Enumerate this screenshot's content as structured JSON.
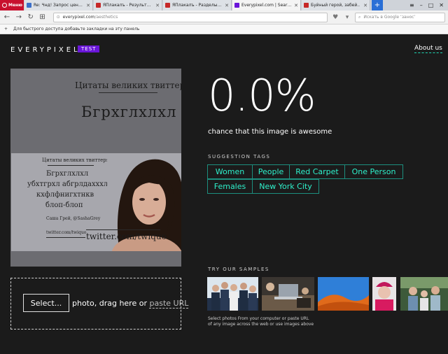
{
  "browser": {
    "menu_label": "Меню",
    "tabs": [
      {
        "title": "Re: Чнд! Запрос цены н...",
        "active": false,
        "favicon_color": "#3b6fc9"
      },
      {
        "title": "ЯПлакалъ - Результаты п...",
        "active": false,
        "favicon_color": "#c62828"
      },
      {
        "title": "ЯПлакалъ - Разделы и...",
        "active": false,
        "favicon_color": "#c62828"
      },
      {
        "title": "Everypixel.com | Search",
        "active": true,
        "favicon_color": "#6a16d9"
      },
      {
        "title": "Буйный герой, забей..",
        "active": false,
        "favicon_color": "#c62828"
      }
    ],
    "url_domain": "everypixel.com",
    "url_path": "/aesthetics",
    "search_placeholder": "Искать в Google ‘занос’",
    "bookmarks_hint": "Для быстрого доступа добавьте закладки на эту панель"
  },
  "header": {
    "logo": "EVERYPIXEL",
    "badge": "TEST",
    "about_link": "About us"
  },
  "image": {
    "poster_title": "Цитаты великих твиттерян",
    "poster_text_big": "Бгрхглхлхл",
    "inner_title": "Цитаты великих твиттерян",
    "inner_line1": "Бгрхглхлхл",
    "inner_line2": "убхтгрхл абгрлдахххлвимг",
    "inner_line3": "кхфлфнигхтнкв",
    "inner_line4": "блоп-блоп",
    "inner_author": "Саша Грей, @SashaGrey",
    "inner_link": "twitter.com/twiquo",
    "poster_link": "twitter.com/twiquo"
  },
  "upload": {
    "select_label": "Select...",
    "text_prefix": "photo, drag here or",
    "paste_link": "paste URL"
  },
  "result": {
    "score": "0.0%",
    "subtitle": "chance that this image is awesome",
    "suggestion_title": "SUGGESTION TAGS",
    "tags": [
      "Women",
      "People",
      "Red Carpet",
      "One Person",
      "Females",
      "New York City"
    ],
    "samples_title": "TRY OUR SAMPLES",
    "samples": [
      "business-team-sample",
      "laptop-office-sample",
      "desert-dunes-sample",
      "winter-girl-sample",
      "family-portrait-sample"
    ],
    "samples_note_line1": "Select photos From your computer or paste URL",
    "samples_note_line2": "of any image across the web or use images above"
  },
  "colors": {
    "accent": "#2ef0cb",
    "tag_border": "#1d8f7f",
    "badge": "#6a16d9",
    "background": "#1b1b1b"
  }
}
